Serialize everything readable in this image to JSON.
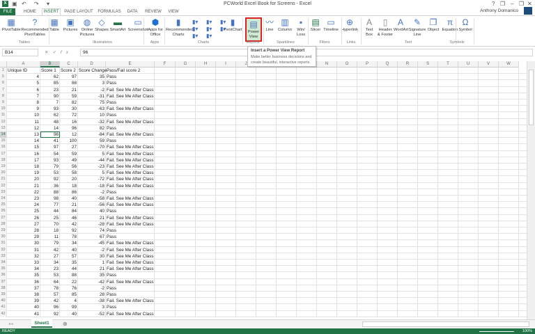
{
  "window": {
    "title": "PCWorld Excel Book for Screens - Excel",
    "user": "Anthony Domanico",
    "help": "?",
    "minimize": "–",
    "restore": "❐",
    "close": "✕"
  },
  "tabs": [
    "FILE",
    "HOME",
    "INSERT",
    "PAGE LAYOUT",
    "FORMULAS",
    "DATA",
    "REVIEW",
    "VIEW"
  ],
  "ribbon": {
    "buttons": [
      {
        "label": "PivotTable",
        "icon": "pivottable-icon",
        "glyph": "▦"
      },
      {
        "label": "Recommended PivotTables",
        "icon": "recommended-pivottables-icon",
        "glyph": "?"
      },
      {
        "label": "Table",
        "icon": "table-icon",
        "glyph": "▦"
      },
      {
        "label": "Pictures",
        "icon": "pictures-icon",
        "glyph": "▣"
      },
      {
        "label": "Online Pictures",
        "icon": "online-pictures-icon",
        "glyph": "◍"
      },
      {
        "label": "Shapes",
        "icon": "shapes-icon",
        "glyph": "◇"
      },
      {
        "label": "SmartArt",
        "icon": "smartart-icon",
        "glyph": "▬"
      },
      {
        "label": "Screenshot",
        "icon": "screenshot-icon",
        "glyph": "▭"
      },
      {
        "label": "Apps for Office",
        "icon": "apps-icon",
        "glyph": "⬢"
      },
      {
        "label": "Recommended Charts",
        "icon": "recommended-charts-icon",
        "glyph": "▮"
      },
      {
        "label": "PivotChart",
        "icon": "pivotchart-icon",
        "glyph": "▮"
      },
      {
        "label": "Power View",
        "icon": "power-view-icon",
        "glyph": "▤"
      },
      {
        "label": "Line",
        "icon": "sparkline-line-icon",
        "glyph": "〰"
      },
      {
        "label": "Column",
        "icon": "sparkline-column-icon",
        "glyph": "▥"
      },
      {
        "label": "Win/ Loss",
        "icon": "sparkline-winloss-icon",
        "glyph": "▪"
      },
      {
        "label": "Slicer",
        "icon": "slicer-icon",
        "glyph": "▤"
      },
      {
        "label": "Timeline",
        "icon": "timeline-icon",
        "glyph": "▭"
      },
      {
        "label": "Hyperlink",
        "icon": "hyperlink-icon",
        "glyph": "⊕"
      },
      {
        "label": "Text Box",
        "icon": "textbox-icon",
        "glyph": "A"
      },
      {
        "label": "Header & Footer",
        "icon": "header-footer-icon",
        "glyph": "▯"
      },
      {
        "label": "WordArt",
        "icon": "wordart-icon",
        "glyph": "A"
      },
      {
        "label": "Signature Line",
        "icon": "signature-icon",
        "glyph": "✎"
      },
      {
        "label": "Object",
        "icon": "object-icon",
        "glyph": "❐"
      },
      {
        "label": "Equation",
        "icon": "equation-icon",
        "glyph": "π"
      },
      {
        "label": "Symbol",
        "icon": "symbol-icon",
        "glyph": "Ω"
      }
    ],
    "groups": [
      "Tables",
      "Illustrations",
      "Apps",
      "Charts",
      "Reports",
      "Sparklines",
      "Filters",
      "Links",
      "Text",
      "Symbols"
    ]
  },
  "tooltip": {
    "title": "Insert a Power View Report",
    "body": "Make better business decisions and create beautiful, interactive reports."
  },
  "formula_bar": {
    "name_box": "B14",
    "fx": "fx",
    "cancel": "✕",
    "enter": "✓",
    "value": "96"
  },
  "columns": [
    "A",
    "B",
    "C",
    "D",
    "E",
    "F",
    "G",
    "H",
    "I",
    "J",
    "K",
    "L",
    "M",
    "N",
    "O",
    "P",
    "Q",
    "R",
    "S",
    "T",
    "U",
    "V",
    "W"
  ],
  "header_row": {
    "num": "1",
    "cells": [
      "Unique ID",
      "Score 1",
      "Score 2",
      "Score Change",
      "Pass/Fail score 2"
    ]
  },
  "rows": [
    [
      "5",
      "4",
      "62",
      "97",
      "35",
      "Pass"
    ],
    [
      "6",
      "5",
      "85",
      "88",
      "3",
      "Pass"
    ],
    [
      "7",
      "6",
      "23",
      "21",
      "-2",
      "Fail. See Me After Class"
    ],
    [
      "8",
      "7",
      "90",
      "59",
      "-31",
      "Fail. See Me After Class"
    ],
    [
      "9",
      "8",
      "7",
      "82",
      "75",
      "Pass"
    ],
    [
      "10",
      "9",
      "93",
      "30",
      "-63",
      "Fail. See Me After Class"
    ],
    [
      "11",
      "10",
      "62",
      "72",
      "10",
      "Pass"
    ],
    [
      "12",
      "11",
      "48",
      "16",
      "-32",
      "Fail. See Me After Class"
    ],
    [
      "13",
      "12",
      "14",
      "96",
      "82",
      "Pass"
    ],
    [
      "14",
      "13",
      "96",
      "12",
      "-84",
      "Fail. See Me After Class"
    ],
    [
      "15",
      "14",
      "41",
      "100",
      "59",
      "Pass"
    ],
    [
      "16",
      "15",
      "97",
      "27",
      "-70",
      "Fail. See Me After Class"
    ],
    [
      "17",
      "16",
      "54",
      "59",
      "5",
      "Fail. See Me After Class"
    ],
    [
      "18",
      "17",
      "93",
      "49",
      "-44",
      "Fail. See Me After Class"
    ],
    [
      "19",
      "18",
      "79",
      "56",
      "-23",
      "Fail. See Me After Class"
    ],
    [
      "20",
      "19",
      "53",
      "58",
      "5",
      "Fail. See Me After Class"
    ],
    [
      "21",
      "20",
      "92",
      "20",
      "-72",
      "Fail. See Me After Class"
    ],
    [
      "22",
      "21",
      "36",
      "18",
      "-18",
      "Fail. See Me After Class"
    ],
    [
      "23",
      "22",
      "88",
      "86",
      "-2",
      "Pass"
    ],
    [
      "24",
      "23",
      "98",
      "40",
      "-58",
      "Fail. See Me After Class"
    ],
    [
      "25",
      "24",
      "77",
      "21",
      "-56",
      "Fail. See Me After Class"
    ],
    [
      "26",
      "25",
      "44",
      "84",
      "40",
      "Pass"
    ],
    [
      "27",
      "26",
      "25",
      "46",
      "21",
      "Fail. See Me After Class"
    ],
    [
      "28",
      "27",
      "70",
      "42",
      "-28",
      "Fail. See Me After Class"
    ],
    [
      "29",
      "28",
      "18",
      "92",
      "74",
      "Pass"
    ],
    [
      "30",
      "29",
      "11",
      "78",
      "67",
      "Pass"
    ],
    [
      "31",
      "30",
      "79",
      "34",
      "-45",
      "Fail. See Me After Class"
    ],
    [
      "32",
      "31",
      "42",
      "40",
      "-2",
      "Fail. See Me After Class"
    ],
    [
      "33",
      "32",
      "27",
      "57",
      "30",
      "Fail. See Me After Class"
    ],
    [
      "34",
      "33",
      "34",
      "35",
      "1",
      "Fail. See Me After Class"
    ],
    [
      "35",
      "34",
      "23",
      "44",
      "21",
      "Fail. See Me After Class"
    ],
    [
      "36",
      "35",
      "53",
      "88",
      "35",
      "Pass"
    ],
    [
      "37",
      "36",
      "64",
      "22",
      "-42",
      "Fail. See Me After Class"
    ],
    [
      "38",
      "37",
      "78",
      "76",
      "-2",
      "Pass"
    ],
    [
      "39",
      "38",
      "57",
      "85",
      "28",
      "Pass"
    ],
    [
      "40",
      "39",
      "42",
      "4",
      "-38",
      "Fail. See Me After Class"
    ],
    [
      "41",
      "40",
      "96",
      "99",
      "3",
      "Pass"
    ],
    [
      "42",
      "41",
      "92",
      "40",
      "-52",
      "Fail. See Me After Class"
    ]
  ],
  "sheet": {
    "tab": "Sheet1",
    "add": "⊕"
  },
  "status": {
    "text": "READY",
    "zoom": "100%"
  },
  "accent": "#217346"
}
